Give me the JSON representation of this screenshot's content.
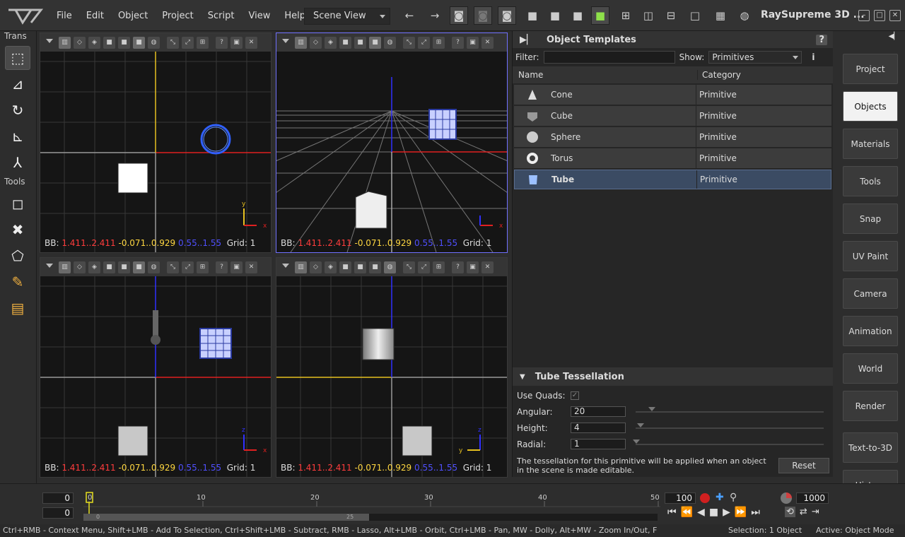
{
  "app": {
    "title": "RaySupreme 3D ..."
  },
  "menu": [
    "File",
    "Edit",
    "Object",
    "Project",
    "Script",
    "View",
    "Help"
  ],
  "toolbar": {
    "view_select": "Scene View"
  },
  "left_tools": {
    "trans_header": "Trans",
    "tools_header": "Tools"
  },
  "viewports": [
    {
      "bb_label": "BB:",
      "x_range": "1.411..2.411",
      "y_range": "-0.071..0.929",
      "z_range": "0.55..1.55",
      "grid": "Grid: 1",
      "axis_up": "y",
      "axis_right": "x"
    },
    {
      "bb_label": "BB:",
      "x_range": "1.411..2.411",
      "y_range": "-0.071..0.929",
      "z_range": "0.55..1.55",
      "grid": "Grid: 1",
      "axis_up": "",
      "axis_right": "x"
    },
    {
      "bb_label": "BB:",
      "x_range": "1.411..2.411",
      "y_range": "-0.071..0.929",
      "z_range": "0.55..1.55",
      "grid": "Grid: 1",
      "axis_up": "z",
      "axis_right": "x"
    },
    {
      "bb_label": "BB:",
      "x_range": "1.411..2.411",
      "y_range": "-0.071..0.929",
      "z_range": "0.55..1.55",
      "grid": "Grid: 1",
      "axis_up": "z",
      "axis_right": "y"
    }
  ],
  "templates": {
    "title": "Object Templates",
    "filter_label": "Filter:",
    "filter_value": "",
    "show_label": "Show:",
    "show_value": "Primitives",
    "col_name": "Name",
    "col_category": "Category",
    "rows": [
      {
        "name": "Cone",
        "category": "Primitive"
      },
      {
        "name": "Cube",
        "category": "Primitive"
      },
      {
        "name": "Sphere",
        "category": "Primitive"
      },
      {
        "name": "Torus",
        "category": "Primitive"
      },
      {
        "name": "Tube",
        "category": "Primitive"
      }
    ]
  },
  "tessellation": {
    "title": "Tube Tessellation",
    "use_quads_label": "Use Quads:",
    "angular_label": "Angular:",
    "angular_value": "20",
    "height_label": "Height:",
    "height_value": "4",
    "radial_label": "Radial:",
    "radial_value": "1",
    "note": "The tessellation for this primitive will be applied when an object in the scene is made editable.",
    "reset_label": "Reset"
  },
  "right_panel": [
    "Project",
    "Objects",
    "Materials",
    "Tools",
    "Snap",
    "UV Paint",
    "Camera",
    "Animation",
    "World",
    "Render",
    "Text-to-3D",
    "History"
  ],
  "timeline": {
    "frame_a": "0",
    "frame_b": "0",
    "ticks": [
      "0",
      "10",
      "20",
      "30",
      "40",
      "50"
    ],
    "scroll_start": "0",
    "scroll_mid": "25",
    "end_frame": "100",
    "total": "1000"
  },
  "status": {
    "hint": "Ctrl+RMB - Context Menu, Shift+LMB - Add To Selection, Ctrl+Shift+LMB - Subtract, RMB - Lasso, Alt+LMB - Orbit, Ctrl+LMB - Pan, MW - Dolly, Alt+MW - Zoom In/Out, F",
    "selection": "Selection: 1 Object",
    "mode": "Active: Object Mode"
  }
}
